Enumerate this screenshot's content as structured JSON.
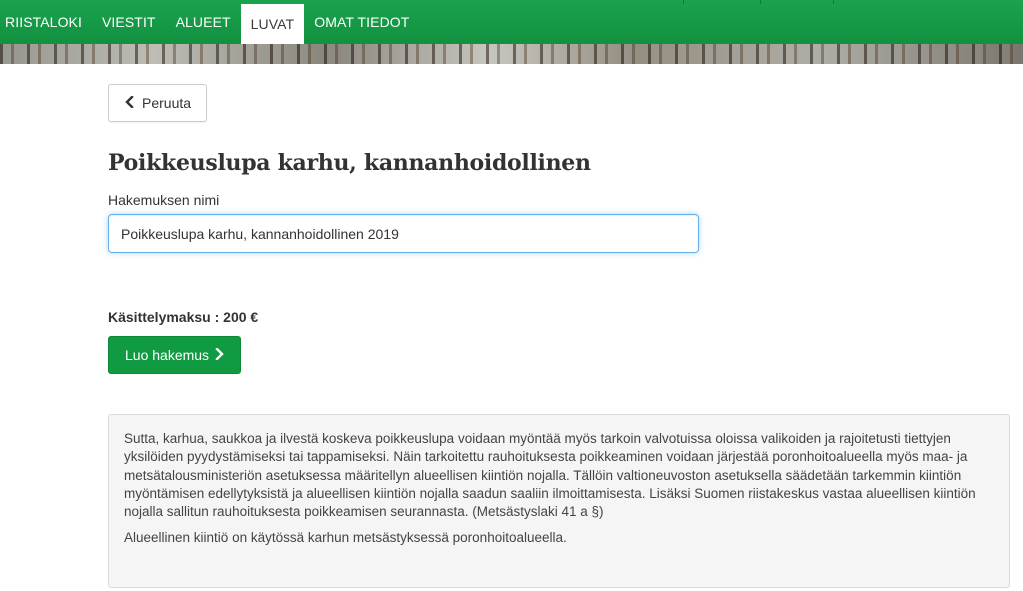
{
  "nav": {
    "items": [
      {
        "label": "RIISTALOKI",
        "active": false
      },
      {
        "label": "VIESTIT",
        "active": false
      },
      {
        "label": "ALUEET",
        "active": false
      },
      {
        "label": "LUVAT",
        "active": true
      },
      {
        "label": "OMAT TIEDOT",
        "active": false
      }
    ]
  },
  "actions": {
    "cancel_label": "Peruuta",
    "create_label": "Luo hakemus"
  },
  "page": {
    "title": "Poikkeuslupa karhu, kannanhoidollinen"
  },
  "form": {
    "name_label": "Hakemuksen nimi",
    "name_value": "Poikkeuslupa karhu, kannanhoidollinen 2019"
  },
  "fee": {
    "text": "Käsittelymaksu : 200 €"
  },
  "info": {
    "paragraph1": "Sutta, karhua, saukkoa ja ilvestä koskeva poikkeuslupa voidaan myöntää myös tarkoin valvotuissa oloissa valikoiden ja rajoitetusti tiettyjen yksilöiden pyydystämiseksi tai tappamiseksi. Näin tarkoitettu rauhoituksesta poikkeaminen voidaan järjestää poronhoitoalueella myös maa- ja metsätalousministeriön asetuksessa määritellyn alueellisen kiintiön nojalla. Tällöin valtioneuvoston asetuksella säädetään tarkemmin kiintiön myöntämisen edellytyksistä ja alueellisen kiintiön nojalla saadun saaliin ilmoittamisesta. Lisäksi Suomen riistakeskus vastaa alueellisen kiintiön nojalla sallitun rauhoituksesta poikkeamisen seurannasta. (Metsästyslaki 41 a §)",
    "paragraph2": "Alueellinen kiintiö on käytössä karhun metsästyksessä poronhoitoalueella."
  },
  "icons": {
    "cancel": "chevron-left-icon",
    "create": "chevron-right-icon"
  },
  "colors": {
    "nav_green": "#12913f",
    "button_green": "#109a41",
    "focus_blue": "#66afe9",
    "info_bg": "#f5f5f5"
  }
}
